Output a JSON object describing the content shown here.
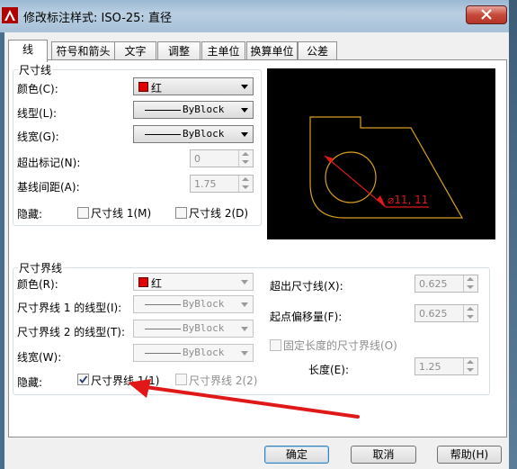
{
  "window": {
    "title": "修改标注样式: ISO-25: 直径",
    "close_label": "×"
  },
  "tabs": [
    {
      "label": "线"
    },
    {
      "label": "符号和箭头"
    },
    {
      "label": "文字"
    },
    {
      "label": "调整"
    },
    {
      "label": "主单位"
    },
    {
      "label": "换算单位"
    },
    {
      "label": "公差"
    }
  ],
  "dim_line": {
    "title": "尺寸线",
    "color_label": "颜色(C):",
    "color_value": "红",
    "linetype_label": "线型(L):",
    "linetype_value": "ByBlock",
    "lineweight_label": "线宽(G):",
    "lineweight_value": "ByBlock",
    "extend_label": "超出标记(N):",
    "extend_value": "0",
    "baseline_label": "基线间距(A):",
    "baseline_value": "1.75",
    "suppress_label": "隐藏:",
    "suppress_1": "尺寸线 1(M)",
    "suppress_2": "尺寸线 2(D)"
  },
  "ext_line": {
    "title": "尺寸界线",
    "color_label": "颜色(R):",
    "color_value": "红",
    "lt1_label": "尺寸界线 1 的线型(I):",
    "lt1_value": "ByBlock",
    "lt2_label": "尺寸界线 2 的线型(T):",
    "lt2_value": "ByBlock",
    "lineweight_label": "线宽(W):",
    "lineweight_value": "ByBlock",
    "suppress_label": "隐藏:",
    "suppress_1": "尺寸界线 1(1)",
    "suppress_1_checked": true,
    "suppress_2": "尺寸界线 2(2)",
    "extend_label": "超出尺寸线(X):",
    "extend_value": "0.625",
    "offset_label": "起点偏移量(F):",
    "offset_value": "0.625",
    "fixed_label": "固定长度的尺寸界线(O)",
    "length_label": "长度(E):",
    "length_value": "1.25"
  },
  "preview": {
    "dimension_text": "⌀11, 11"
  },
  "buttons": {
    "ok": "确定",
    "cancel": "取消",
    "help": "帮助(H)"
  },
  "colors": {
    "accent_red": "#e00000",
    "preview_bg": "#000000",
    "preview_line": "#d8a020",
    "annotation_arrow": "#e01818"
  }
}
